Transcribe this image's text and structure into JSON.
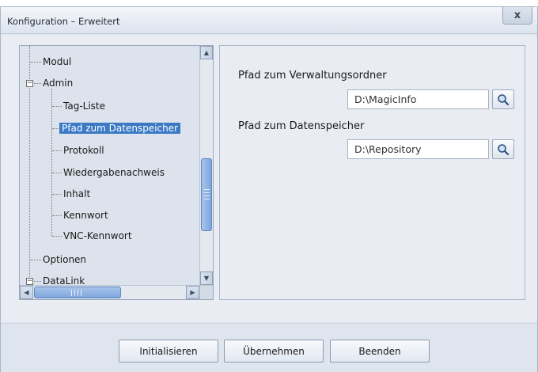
{
  "window": {
    "title": "Konfiguration – Erweitert",
    "close_label": "x"
  },
  "tree": {
    "items": [
      {
        "label": "Modul",
        "level": 0,
        "selected": false
      },
      {
        "label": "Admin",
        "level": 0,
        "expanded": true,
        "selected": false
      },
      {
        "label": "Tag-Liste",
        "level": 1,
        "selected": false
      },
      {
        "label": "Pfad zum Datenspeicher",
        "level": 1,
        "selected": true
      },
      {
        "label": "Protokoll",
        "level": 1,
        "selected": false
      },
      {
        "label": "Wiedergabenachweis",
        "level": 1,
        "selected": false
      },
      {
        "label": "Inhalt",
        "level": 1,
        "selected": false
      },
      {
        "label": "Kennwort",
        "level": 1,
        "selected": false
      },
      {
        "label": "VNC-Kennwort",
        "level": 1,
        "selected": false
      },
      {
        "label": "Optionen",
        "level": 0,
        "selected": false
      },
      {
        "label": "DataLink",
        "level": 0,
        "expanded": true,
        "selected": false
      }
    ]
  },
  "settings": {
    "management_folder_label": "Pfad zum Verwaltungsordner",
    "management_folder_value": "D:\\MagicInfo",
    "repository_label": "Pfad zum Datenspeicher",
    "repository_value": "D:\\Repository"
  },
  "buttons": {
    "initialize": "Initialisieren",
    "apply": "Übernehmen",
    "exit": "Beenden"
  },
  "colors": {
    "selection": "#3b79c4",
    "window_bg": "#dfe5ee",
    "scroll_thumb": "#7fa6dc"
  }
}
